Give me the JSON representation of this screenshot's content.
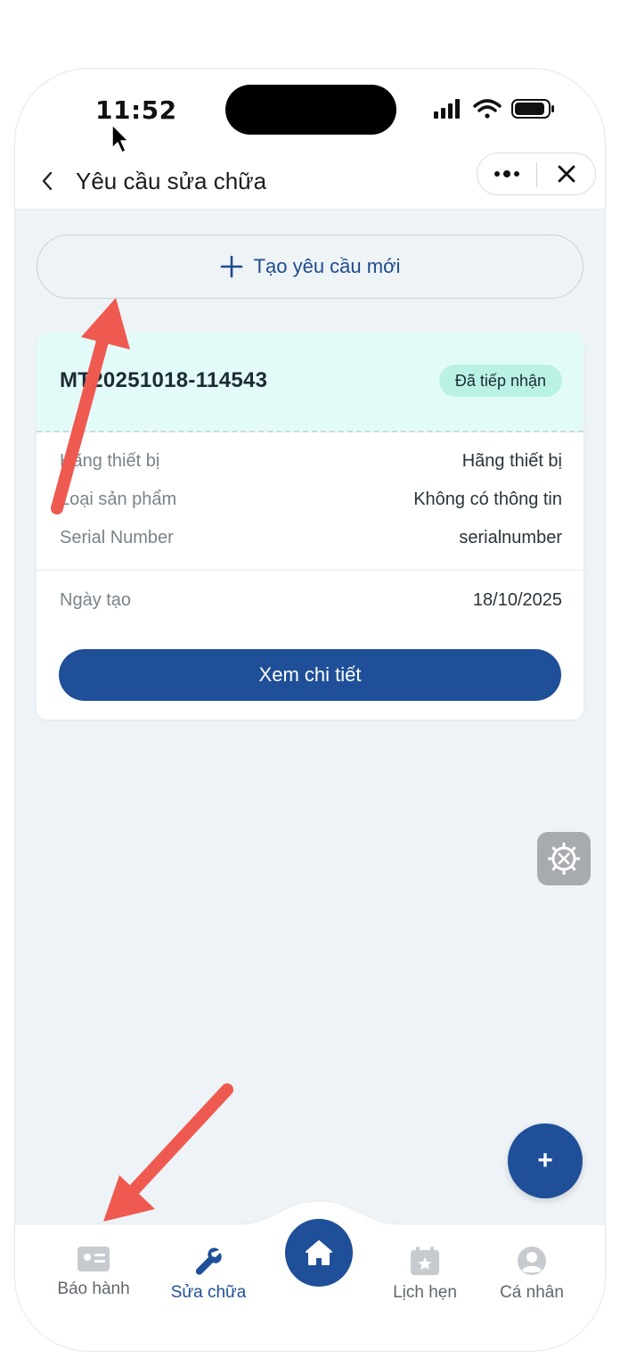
{
  "status": {
    "time": "11:52"
  },
  "header": {
    "title": "Yêu cầu sửa chữa"
  },
  "create": {
    "label": "Tạo yêu cầu mới"
  },
  "card": {
    "id": "MT20251018-114543",
    "status": "Đã tiếp nhận",
    "fields": [
      {
        "key": "Hãng thiết bị",
        "value": "Hãng thiết bị"
      },
      {
        "key": "Loại sản phẩm",
        "value": "Không có thông tin"
      },
      {
        "key": "Serial Number",
        "value": "serialnumber"
      }
    ],
    "created": {
      "key": "Ngày tạo",
      "value": "18/10/2025"
    },
    "action": "Xem chi tiết"
  },
  "fab": {
    "add": "+"
  },
  "tabbar": {
    "items": [
      {
        "label": "Báo hành",
        "icon": "id-card-icon"
      },
      {
        "label": "Sửa chữa",
        "icon": "wrench-icon",
        "active": true
      },
      {
        "label": "",
        "icon": "home-icon"
      },
      {
        "label": "Lịch hẹn",
        "icon": "calendar-star-icon"
      },
      {
        "label": "Cá nhân",
        "icon": "user-circle-icon"
      }
    ]
  },
  "colors": {
    "primary": "#1f4f98",
    "badge_bg": "#b9f1e4",
    "card_head_bg": "#e3fbf8",
    "annotation_arrow": "#ef5a50"
  }
}
